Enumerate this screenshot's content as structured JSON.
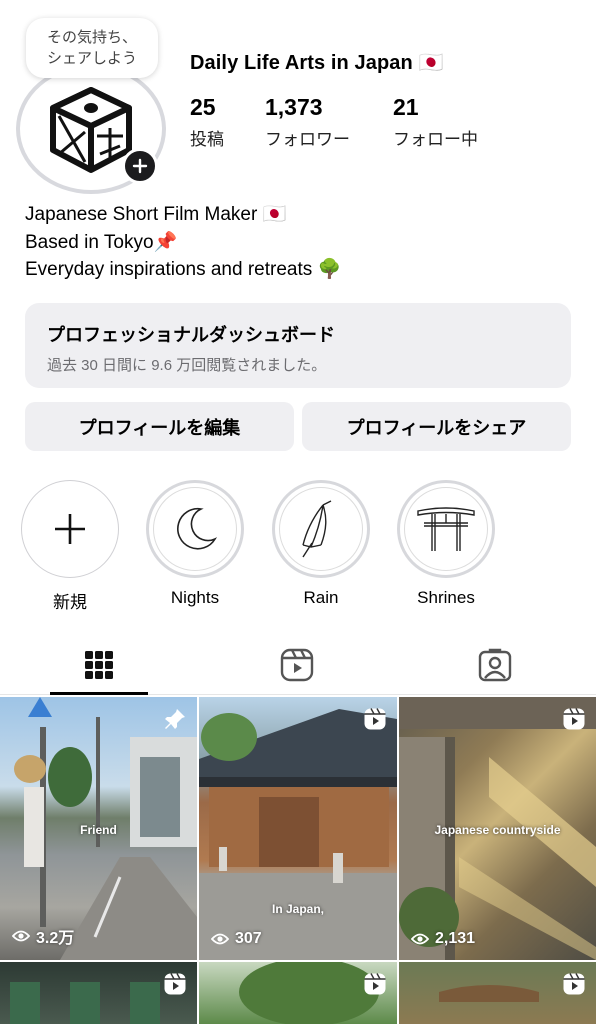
{
  "profile": {
    "note_line1": "その気持ち、",
    "note_line2": "シェアしよう",
    "name": "Daily Life Arts in Japan 🇯🇵",
    "stats": {
      "posts_count": "25",
      "posts_label": "投稿",
      "followers_count": "1,373",
      "followers_label": "フォロワー",
      "following_count": "21",
      "following_label": "フォロー中"
    },
    "bio_lines": [
      "Japanese Short Film Maker 🇯🇵",
      "Based in Tokyo📌",
      "Everyday inspirations and retreats 🌳"
    ]
  },
  "dashboard": {
    "title": "プロフェッショナルダッシュボード",
    "subtitle": "過去 30 日間に 9.6 万回閲覧されました。"
  },
  "buttons": {
    "edit_profile": "プロフィールを編集",
    "share_profile": "プロフィールをシェア"
  },
  "highlights": [
    {
      "label": "新規",
      "icon": "plus-icon"
    },
    {
      "label": "Nights",
      "icon": "moon-icon"
    },
    {
      "label": "Rain",
      "icon": "umbrella-icon"
    },
    {
      "label": "Shrines",
      "icon": "torii-icon"
    }
  ],
  "tabs": {
    "active": "grid",
    "items": [
      "grid-icon",
      "reels-icon",
      "tagged-icon"
    ]
  },
  "posts": [
    {
      "caption": "Friend",
      "views": "3.2万",
      "badge": "pin-icon"
    },
    {
      "caption": "In Japan,",
      "views": "307",
      "badge": "reel-icon"
    },
    {
      "caption": "Japanese countryside",
      "views": "2,131",
      "badge": "reel-icon"
    },
    {
      "caption": "",
      "views": "",
      "badge": "reel-icon"
    },
    {
      "caption": "",
      "views": "",
      "badge": "reel-icon"
    },
    {
      "caption": "",
      "views": "",
      "badge": "reel-icon"
    }
  ],
  "colors": {
    "button_bg": "#efeff2",
    "ring": "#d8d9de",
    "text": "#000000"
  }
}
